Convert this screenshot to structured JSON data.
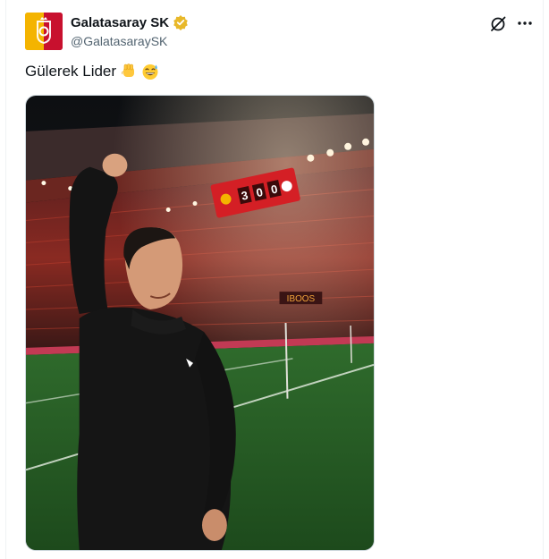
{
  "author": {
    "display_name": "Galatasaray SK",
    "handle": "@GalatasaraySK",
    "verified_badge": "gold-verified-badge-icon"
  },
  "tweet": {
    "text": "Gülerek Lider",
    "emojis": [
      "raised-fist-emoji",
      "grinning-sweat-emoji"
    ]
  },
  "actions": {
    "grok": "grok-icon",
    "more": "more-icon"
  },
  "media": {
    "scoreboard": {
      "home": "3",
      "separator": "0",
      "away": "0"
    },
    "stadium_sign": "IBOOS"
  },
  "colors": {
    "club_yellow": "#f4b400",
    "club_red": "#c8102e",
    "handle_gray": "#536471",
    "verified_gold": "#e8b829"
  }
}
